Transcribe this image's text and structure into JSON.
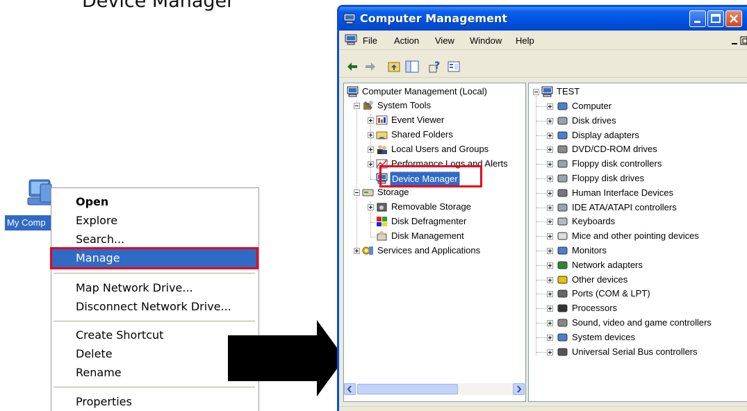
{
  "caption": "Device Manager",
  "desktop": {
    "icon_label": "My Comp",
    "icon": "my-computer-icon"
  },
  "context_menu": {
    "items": [
      {
        "label": "Open",
        "bold": true
      },
      {
        "label": "Explore"
      },
      {
        "label": "Search..."
      },
      {
        "label": "Manage",
        "highlighted": true
      },
      {
        "label": "Map Network Drive..."
      },
      {
        "label": "Disconnect Network Drive..."
      },
      {
        "label": "Create Shortcut"
      },
      {
        "label": "Delete"
      },
      {
        "label": "Rename"
      },
      {
        "label": "Properties"
      }
    ]
  },
  "window": {
    "title": "Computer Management",
    "menu": [
      "File",
      "Action",
      "View",
      "Window",
      "Help"
    ],
    "left_tree": [
      {
        "label": "Computer Management (Local)",
        "icon": "computer-management-icon"
      },
      {
        "label": "System Tools",
        "icon": "system-tools-icon"
      },
      {
        "label": "Event Viewer",
        "icon": "event-viewer-icon"
      },
      {
        "label": "Shared Folders",
        "icon": "shared-folders-icon"
      },
      {
        "label": "Local Users and Groups",
        "icon": "users-icon"
      },
      {
        "label": "Performance Logs and Alerts",
        "icon": "performance-icon"
      },
      {
        "label": "Device Manager",
        "icon": "device-manager-icon",
        "selected": true
      },
      {
        "label": "Storage",
        "icon": "storage-icon"
      },
      {
        "label": "Removable Storage",
        "icon": "removable-storage-icon"
      },
      {
        "label": "Disk Defragmenter",
        "icon": "defrag-icon"
      },
      {
        "label": "Disk Management",
        "icon": "disk-management-icon"
      },
      {
        "label": "Services and Applications",
        "icon": "services-icon"
      }
    ],
    "right_root": "TEST",
    "devices": [
      "Computer",
      "Disk drives",
      "Display adapters",
      "DVD/CD-ROM drives",
      "Floppy disk controllers",
      "Floppy disk drives",
      "Human Interface Devices",
      "IDE ATA/ATAPI controllers",
      "Keyboards",
      "Mice and other pointing devices",
      "Monitors",
      "Network adapters",
      "Other devices",
      "Ports (COM & LPT)",
      "Processors",
      "Sound, video and game controllers",
      "System devices",
      "Universal Serial Bus controllers"
    ]
  },
  "colors": {
    "highlight": "#316ac5",
    "annotation_red": "#e8001c",
    "titlebar": "#0054e3"
  }
}
